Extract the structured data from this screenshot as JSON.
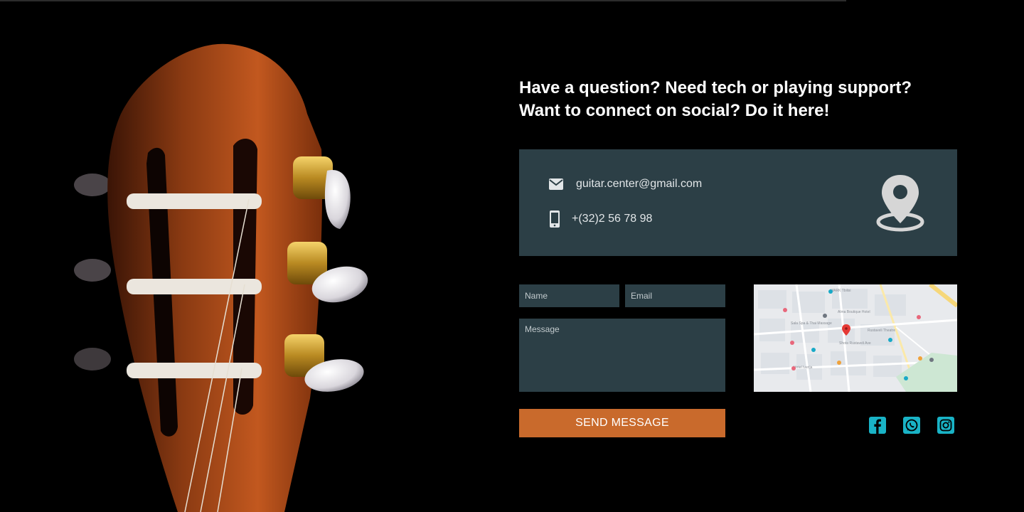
{
  "headline": {
    "line1": "Have a question? Need tech or playing support?",
    "line2": "Want to connect on social? Do it here!"
  },
  "contact": {
    "email": "guitar.center@gmail.com",
    "phone": "+(32)2 56 78 98",
    "email_icon": "envelope-icon",
    "phone_icon": "mobile-phone-icon",
    "location_icon": "map-pin-icon"
  },
  "form": {
    "name_placeholder": "Name",
    "email_placeholder": "Email",
    "message_placeholder": "Message",
    "send_label": "SEND MESSAGE"
  },
  "social": [
    {
      "name": "facebook",
      "icon": "facebook-icon"
    },
    {
      "name": "whatsapp",
      "icon": "whatsapp-icon"
    },
    {
      "name": "instagram",
      "icon": "instagram-icon"
    }
  ],
  "colors": {
    "background": "#000000",
    "card": "#2c3f46",
    "accent": "#c96a2c",
    "social": "#19b3c6"
  }
}
